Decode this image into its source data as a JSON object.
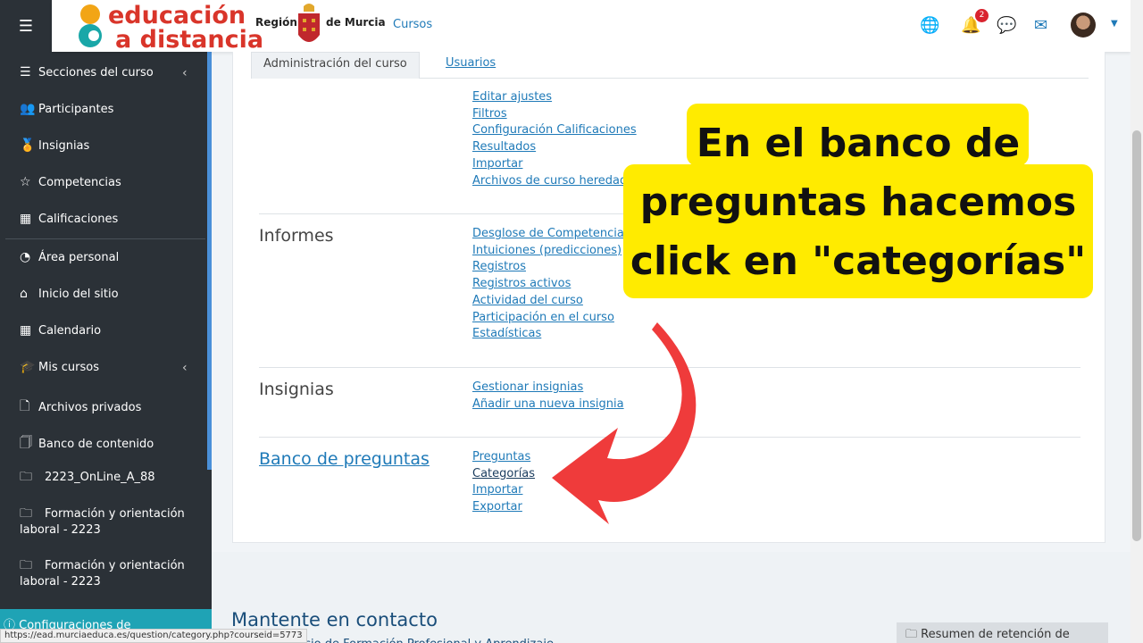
{
  "topbar": {
    "logo_line1": "educación",
    "logo_line2": "a distancia",
    "region_left": "Región",
    "region_right": "de Murcia",
    "cursos_link": "Cursos",
    "notification_count": "2"
  },
  "sidebar": {
    "items": [
      {
        "icon": "☰",
        "label": "Secciones del curso"
      },
      {
        "icon": "👥",
        "label": "Participantes"
      },
      {
        "icon": "🏅",
        "label": "Insignias"
      },
      {
        "icon": "☆",
        "label": "Competencias"
      },
      {
        "icon": "▦",
        "label": "Calificaciones"
      },
      {
        "icon": "◔",
        "label": "Área personal"
      },
      {
        "icon": "⌂",
        "label": "Inicio del sitio"
      },
      {
        "icon": "▦",
        "label": "Calendario"
      },
      {
        "icon": "🎓",
        "label": "Mis cursos"
      },
      {
        "icon": "🗋",
        "label": "Archivos privados"
      },
      {
        "icon": "🗍",
        "label": "Banco de contenido"
      }
    ],
    "courses": [
      "2223_OnLine_A_88",
      "Formación y orientación laboral - 2223",
      "Formación y orientación laboral - 2223"
    ],
    "accessibility": "Configuraciones de accesibilidad"
  },
  "tabs": {
    "admin": "Administración del curso",
    "users": "Usuarios"
  },
  "sections": {
    "general_links": [
      "Editar ajustes",
      "Filtros",
      "Configuración Calificaciones",
      "Resultados",
      "Importar",
      "Archivos de curso heredados"
    ],
    "informes_title": "Informes",
    "informes_links": [
      "Desglose de Competencias",
      "Intuiciones (predicciones)",
      "Registros",
      "Registros activos",
      "Actividad del curso",
      "Participación en el curso",
      "Estadísticas"
    ],
    "insignias_title": "Insignias",
    "insignias_links": [
      "Gestionar insignias",
      "Añadir una nueva insignia"
    ],
    "banco_title": "Banco de preguntas",
    "banco_links": [
      "Preguntas",
      "Categorías",
      "Importar",
      "Exportar"
    ]
  },
  "callout": {
    "line1": "En el banco de",
    "line2": "preguntas hacemos",
    "line3": "click en \"categorías\""
  },
  "footer": {
    "title": "Mantente en contacto",
    "subtitle": "Servicio de Formación Profesional y Aprendizaje",
    "retention": "Resumen de retención de datos",
    "status_url": "https://ead.murciaeduca.es/question/category.php?courseid=5773"
  },
  "colors": {
    "accent": "#1f7ab8",
    "sidebar": "#2b3137",
    "callout": "#ffeb00",
    "arrow": "#ef3b3b"
  }
}
